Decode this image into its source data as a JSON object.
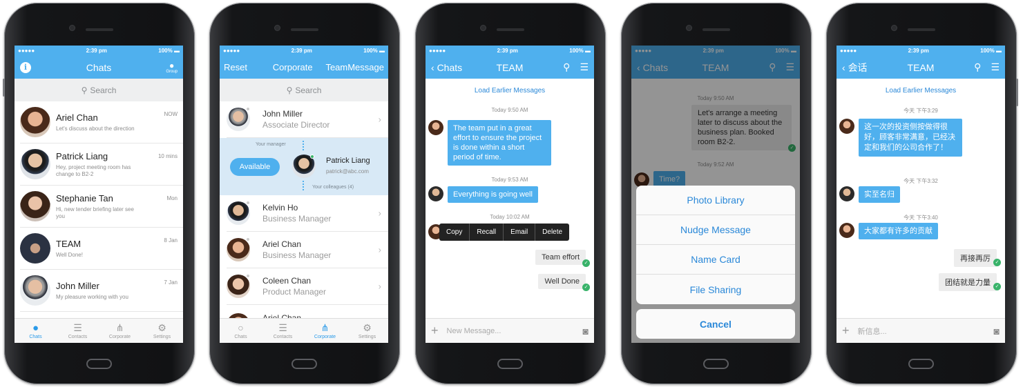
{
  "status": {
    "carrier": "●●●●●",
    "time": "2:39 pm",
    "battery": "100%"
  },
  "status_zh": {
    "carrier": "●●●●●",
    "time": "2:39 pm",
    "battery": "100%"
  },
  "phone1": {
    "title": "Chats",
    "group_label": "Group",
    "search": "Search",
    "chats": [
      {
        "name": "Ariel Chan",
        "preview": "Let's discuss about the direction",
        "time": "NOW"
      },
      {
        "name": "Patrick Liang",
        "preview": "Hey, project meeting room has change to B2-2",
        "time": "10 mins"
      },
      {
        "name": "Stephanie Tan",
        "preview": "Hi, new tender briefing later see you",
        "time": "Mon"
      },
      {
        "name": "TEAM",
        "preview": "Well Done!",
        "time": "8 Jan"
      },
      {
        "name": "John Miller",
        "preview": "My pleasure working with you",
        "time": "7 Jan"
      }
    ],
    "tabs": [
      "Chats",
      "Contacts",
      "Corporate",
      "Settings"
    ]
  },
  "phone2": {
    "left": "Reset",
    "title": "Corporate",
    "right": "TeamMessage",
    "search": "Search",
    "manager_label": "Your manager",
    "colleagues_label": "Your colleagues",
    "colleagues_count": "(4)",
    "available": "Available",
    "current": {
      "name": "Patrick Liang",
      "email": "patrick@abc.com"
    },
    "boss": {
      "name": "John Miller",
      "role": "Associate Director"
    },
    "contacts": [
      {
        "name": "Kelvin Ho",
        "role": "Business Manager"
      },
      {
        "name": "Ariel Chan",
        "role": "Business Manager"
      },
      {
        "name": "Coleen Chan",
        "role": "Product Manager"
      },
      {
        "name": "Ariel Chan",
        "role": ""
      }
    ],
    "tabs": [
      "Chats",
      "Contacts",
      "Corporate",
      "Settings"
    ]
  },
  "phone3": {
    "back": "Chats",
    "title": "TEAM",
    "load": "Load Earlier Messages",
    "t1": "Today 9:50 AM",
    "m1": "The team put in a great effort to ensure the project is done within a short period of time.",
    "t2": "Today 9:53 AM",
    "m2": "Everything is going well",
    "t3": "Today 10:02 AM",
    "menu": [
      "Copy",
      "Recall",
      "Email",
      "Delete"
    ],
    "o1": "Team effort",
    "o2": "Well Done",
    "placeholder": "New Message..."
  },
  "phone4": {
    "back": "Chats",
    "title": "TEAM",
    "t1": "Today 9:50 AM",
    "m1": "Let's arrange a meeting later to discuss about the business plan. Booked room B2-2.",
    "t2": "Today 9:52 AM",
    "m2": "Time?",
    "sheet": [
      "Photo Library",
      "Nudge Message",
      "Name Card",
      "File Sharing"
    ],
    "cancel": "Cancel"
  },
  "phone5": {
    "back": "会话",
    "title": "TEAM",
    "load": "Load Earlier Messages",
    "t1": "今天 下午3:29",
    "m1": "这一次的投资侧按做得很好，顾客非常满意，已经决定和我们的公司合作了！",
    "t2": "今天 下午3:32",
    "m2": "实至名归",
    "t3": "今天 下午3:40",
    "m3": "大家都有许多的贡献",
    "o1": "再接再厉",
    "o2": "团结就是力量",
    "placeholder": "新信息..."
  },
  "colors": {
    "accent": "#4fb0ee",
    "link": "#2a88d8",
    "online": "#39b36a"
  }
}
